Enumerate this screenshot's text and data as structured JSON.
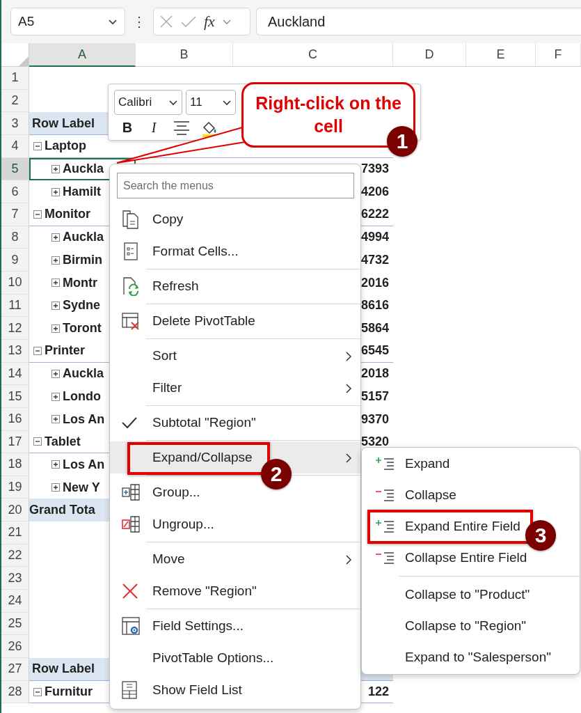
{
  "formula_bar": {
    "name_box": "A5",
    "more": "⋮",
    "function_label": "fx",
    "formula": "Auckland"
  },
  "sheet": {
    "columns": [
      {
        "label": "A",
        "selected": true
      },
      {
        "label": "B",
        "selected": false
      },
      {
        "label": "C",
        "selected": false
      },
      {
        "label": "D",
        "selected": false
      },
      {
        "label": "E",
        "selected": false
      },
      {
        "label": "F",
        "selected": false
      }
    ],
    "rows": [
      {
        "number": "1",
        "selected": false
      },
      {
        "number": "2",
        "selected": false
      },
      {
        "number": "3",
        "selected": false
      },
      {
        "number": "4",
        "selected": false
      },
      {
        "number": "5",
        "selected": true
      },
      {
        "number": "6",
        "selected": false
      },
      {
        "number": "7",
        "selected": false
      },
      {
        "number": "8",
        "selected": false
      },
      {
        "number": "9",
        "selected": false
      },
      {
        "number": "10",
        "selected": false
      },
      {
        "number": "11",
        "selected": false
      },
      {
        "number": "12",
        "selected": false
      },
      {
        "number": "13",
        "selected": false
      },
      {
        "number": "14",
        "selected": false
      },
      {
        "number": "15",
        "selected": false
      },
      {
        "number": "16",
        "selected": false
      },
      {
        "number": "17",
        "selected": false
      },
      {
        "number": "18",
        "selected": false
      },
      {
        "number": "19",
        "selected": false
      },
      {
        "number": "20",
        "selected": false
      },
      {
        "number": "21",
        "selected": false
      },
      {
        "number": "22",
        "selected": false
      },
      {
        "number": "23",
        "selected": false
      },
      {
        "number": "24",
        "selected": false
      },
      {
        "number": "25",
        "selected": false
      },
      {
        "number": "26",
        "selected": false
      },
      {
        "number": "27",
        "selected": false
      },
      {
        "number": "28",
        "selected": false
      }
    ],
    "pivot_tables": [
      {
        "header": "Row Label",
        "groups": [
          {
            "label": "Laptop",
            "expanded": true,
            "children": [
              {
                "label": "Auckla",
                "expanded": false,
                "value_c": "7393"
              },
              {
                "label": "Hamilt",
                "expanded": false,
                "value_c": "4206"
              }
            ]
          },
          {
            "label": "Monitor",
            "expanded": true,
            "value_c": "6222",
            "children": [
              {
                "label": "Auckla",
                "expanded": false,
                "value_c": "4994"
              },
              {
                "label": "Birmin",
                "expanded": false,
                "value_c": "4732"
              },
              {
                "label": "Montr",
                "expanded": false,
                "value_c": "2016"
              },
              {
                "label": "Sydne",
                "expanded": false,
                "value_c": "8616"
              },
              {
                "label": "Toront",
                "expanded": false,
                "value_c": "5864"
              }
            ]
          },
          {
            "label": "Printer",
            "expanded": true,
            "value_c": "6545",
            "children": [
              {
                "label": "Auckla",
                "expanded": false,
                "value_c": "2018"
              },
              {
                "label": "Londo",
                "expanded": false,
                "value_c": "5157"
              },
              {
                "label": "Los An",
                "expanded": false,
                "value_c": "9370"
              }
            ]
          },
          {
            "label": "Tablet",
            "expanded": true,
            "value_c": "5320",
            "children": [
              {
                "label": "Los An",
                "expanded": false
              },
              {
                "label": "New Y",
                "expanded": false
              }
            ]
          }
        ],
        "total": "Grand Tota"
      },
      {
        "header": "Row Label",
        "groups": [
          {
            "label": "Furnitur",
            "expanded": true,
            "value_c": "122"
          }
        ]
      }
    ]
  },
  "mini_toolbar": {
    "font": "Calibri",
    "size": "11",
    "buttons": [
      "B",
      "I"
    ]
  },
  "callout": {
    "text": "Right-click on the cell",
    "badge": "1"
  },
  "context_menu": {
    "search_placeholder": "Search the menus",
    "items": [
      {
        "kind": "command",
        "label": "Copy",
        "selected": false
      },
      {
        "kind": "command",
        "label": "Format Cells...",
        "selected": false
      },
      {
        "kind": "separator"
      },
      {
        "kind": "command",
        "label": "Refresh",
        "selected": false
      },
      {
        "kind": "separator"
      },
      {
        "kind": "command",
        "label": "Delete PivotTable",
        "selected": false
      },
      {
        "kind": "separator"
      },
      {
        "kind": "submenu",
        "label": "Sort",
        "selected": false
      },
      {
        "kind": "submenu",
        "label": "Filter",
        "selected": false
      },
      {
        "kind": "separator"
      },
      {
        "kind": "check",
        "label": "Subtotal \"Region\"",
        "selected": false,
        "checked": true
      },
      {
        "kind": "separator"
      },
      {
        "kind": "submenu",
        "label": "Expand/Collapse",
        "selected": true,
        "highlighted": true,
        "badge": "2"
      },
      {
        "kind": "separator"
      },
      {
        "kind": "command",
        "label": "Group...",
        "selected": false
      },
      {
        "kind": "command",
        "label": "Ungroup...",
        "selected": false
      },
      {
        "kind": "separator"
      },
      {
        "kind": "submenu",
        "label": "Move",
        "selected": false
      },
      {
        "kind": "command",
        "label": "Remove \"Region\"",
        "selected": false
      },
      {
        "kind": "separator"
      },
      {
        "kind": "command",
        "label": "Field Settings...",
        "selected": false
      },
      {
        "kind": "command",
        "label": "PivotTable Options...",
        "selected": false
      },
      {
        "kind": "command",
        "label": "Show Field List",
        "selected": false
      }
    ]
  },
  "submenu": {
    "items": [
      {
        "kind": "command",
        "label": "Expand",
        "highlighted": false
      },
      {
        "kind": "command",
        "label": "Collapse",
        "highlighted": false
      },
      {
        "kind": "command",
        "label": "Expand Entire Field",
        "highlighted": true,
        "badge": "3"
      },
      {
        "kind": "command",
        "label": "Collapse Entire Field",
        "highlighted": false
      },
      {
        "kind": "separator"
      },
      {
        "kind": "command",
        "label": "Collapse to \"Product\"",
        "highlighted": false
      },
      {
        "kind": "command",
        "label": "Collapse to \"Region\"",
        "highlighted": false
      },
      {
        "kind": "command",
        "label": "Expand to \"Salesperson\"",
        "highlighted": false
      }
    ]
  }
}
